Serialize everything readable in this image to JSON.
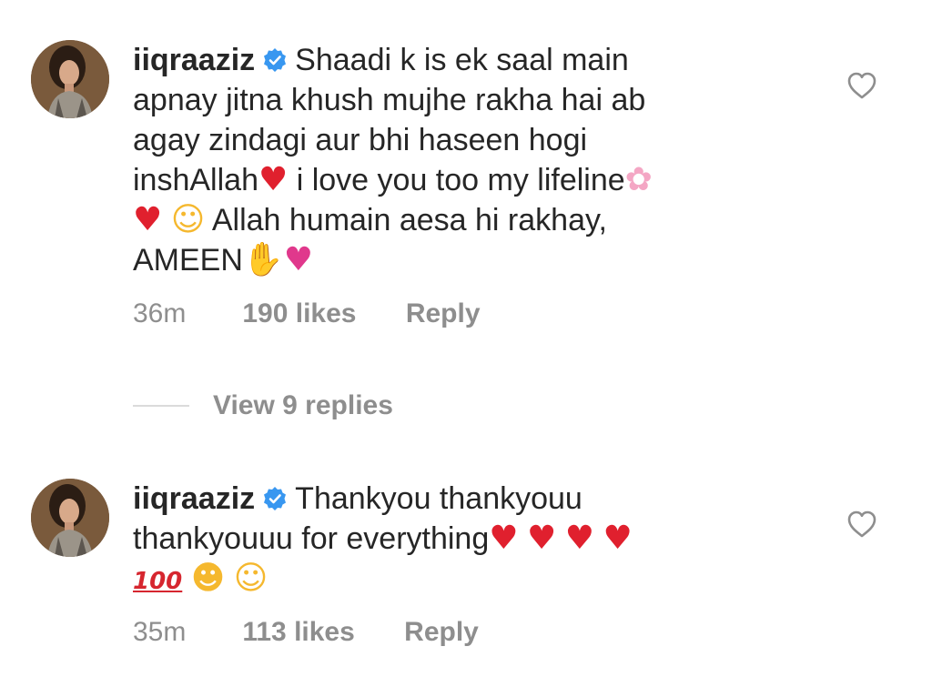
{
  "comments": [
    {
      "username": "iiqraaziz",
      "lines": [
        "Shaadi k is ek saal main",
        "apnay jitna khush mujhe rakha hai ab",
        "agay zindagi aur bhi haseen hogi",
        "inshAllah",
        " i love you too my lifeline",
        " Allah humain aesa hi rakhay,",
        "AMEEN"
      ],
      "time": "36m",
      "likes": "190 likes",
      "reply": "Reply"
    },
    {
      "username": "iiqraaziz",
      "lines": [
        "Thankyou thankyouu",
        "thankyouuu for everything"
      ],
      "time": "35m",
      "likes": "113 likes",
      "reply": "Reply"
    }
  ],
  "view_replies": "View 9 replies",
  "icons": {
    "verified": "verified-badge-icon",
    "like": "heart-outline-icon"
  },
  "colors": {
    "text": "#262626",
    "secondary": "#8e8e8e",
    "verified": "#3897f0"
  }
}
